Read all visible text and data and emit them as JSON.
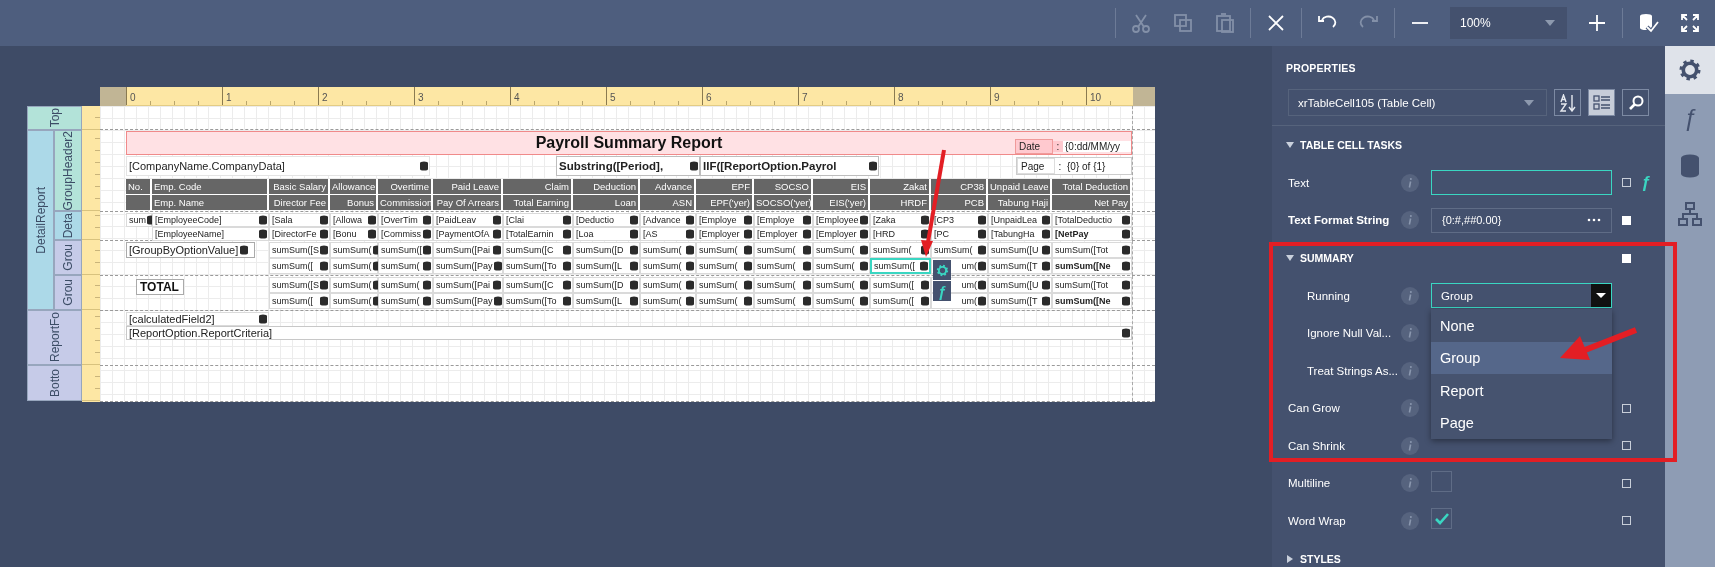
{
  "toolbar": {
    "groups": [
      {
        "buttons": [
          {
            "kind": "cut",
            "disabled": true
          },
          {
            "kind": "copy",
            "disabled": true
          },
          {
            "kind": "paste",
            "disabled": true
          }
        ]
      },
      {
        "buttons": [
          {
            "kind": "delete",
            "disabled": false
          }
        ]
      },
      {
        "buttons": [
          {
            "kind": "undo",
            "disabled": false
          },
          {
            "kind": "redo",
            "disabled": true
          }
        ]
      },
      {
        "buttons": [
          {
            "kind": "zoom_out",
            "disabled": false
          },
          {
            "kind": "zoom",
            "value": "100%",
            "disabled": false
          },
          {
            "kind": "zoom_in",
            "disabled": false
          }
        ]
      },
      {
        "buttons": [
          {
            "kind": "validate",
            "disabled": false
          },
          {
            "kind": "fullscreen",
            "disabled": false
          }
        ]
      }
    ]
  },
  "report": {
    "ruler": [
      "0",
      "1",
      "2",
      "3",
      "4",
      "5",
      "6",
      "7",
      "8",
      "9",
      "10"
    ],
    "bands": [
      {
        "kind": "top_margin",
        "label": "Top",
        "color": "#b3e3d9"
      },
      {
        "kind": "detail_report",
        "label": "DetailReport",
        "color": "#acd9e8",
        "children": [
          {
            "kind": "group_header",
            "label": "GroupHeader2",
            "color": "#b3e3d9",
            "title": "Payroll Summary Report",
            "date": {
              "label": "Date",
              "separator": ":",
              "value": "{0:dd/MM/yy"
            },
            "page": {
              "label": "Page",
              "separator": ":",
              "value": "{0} of {1}"
            },
            "company": "[CompanyName.CompanyData]",
            "period": "Substring([Period],",
            "option": "IIF([ReportOption.Payrol",
            "header_lines": [
              [
                "No.",
                "Emp. Code",
                "Basic Salary",
                "Allowance",
                "Overtime",
                "Paid Leave",
                "Claim",
                "Deduction",
                "Advance",
                "EPF",
                "SOCSO",
                "EIS",
                "Zakat",
                "CP38",
                "Unpaid Leave",
                "Total Deduction"
              ],
              [
                "Emp. Name",
                "Director Fee",
                "Bonus",
                "Commission",
                "Pay Of Arrears",
                "Total Earning",
                "Loan",
                "ASN",
                "EPF('yer)",
                "SOCSO('yer)",
                "EIS('yer)",
                "HRDF",
                "PCB",
                "Tabung Haji",
                "Net Pay"
              ]
            ]
          },
          {
            "kind": "detail",
            "label": "Deta",
            "color": "#acd9e8",
            "lines": [
              {
                "emphasize_last": false,
                "cells": [
                  "sum",
                  "[EmployeeCode]",
                  "[Sala",
                  "[Allowa",
                  "[OverTim",
                  "[PaidLeav",
                  "[Clai",
                  "[Deductio",
                  "[Advance",
                  "[Employe",
                  "[Employe",
                  "[Employee",
                  "[Zaka",
                  "[CP3",
                  "[UnpaidLea",
                  "[TotalDeductio"
                ]
              },
              {
                "emphasize_last": true,
                "cells": [
                  "[EmployeeName]",
                  "[DirectorFe",
                  "[Bonu",
                  "[Commiss",
                  "[PaymentOfA",
                  "[TotalEarnin",
                  "[Loa",
                  "[AS",
                  "[Employer",
                  "[Employer",
                  "[Employer",
                  "[HRD",
                  "[PC",
                  "[TabungHa",
                  "[NetPay"
                ]
              }
            ]
          },
          {
            "kind": "group_footer",
            "label": "Grou",
            "color": "#c6cbe8",
            "caption": {
              "kind": "field",
              "text": "[GroupByOptionValue]"
            },
            "lines": [
              {
                "emphasize_last": false,
                "cells": [
                  {
                    "text": "sumSum([S",
                    "selected": false
                  },
                  {
                    "text": "sumSum(",
                    "selected": false
                  },
                  {
                    "text": "sumSum([",
                    "selected": false
                  },
                  {
                    "text": "sumSum([Pai",
                    "selected": false
                  },
                  {
                    "text": "sumSum([C",
                    "selected": false
                  },
                  {
                    "text": "sumSum([D",
                    "selected": false
                  },
                  {
                    "text": "sumSum(",
                    "selected": false
                  },
                  {
                    "text": "sumSum(",
                    "selected": false
                  },
                  {
                    "text": "sumSum(",
                    "selected": false
                  },
                  {
                    "text": "sumSum(",
                    "selected": false
                  },
                  {
                    "text": "sumSum(",
                    "selected": false
                  },
                  {
                    "text": "sumSum(",
                    "selected": false
                  },
                  {
                    "text": "sumSum([U",
                    "selected": false
                  },
                  {
                    "text": "sumSum([Tot",
                    "selected": false
                  }
                ]
              },
              {
                "emphasize_last": true,
                "cells": [
                  {
                    "text": "sumSum([",
                    "selected": false
                  },
                  {
                    "text": "sumSum(",
                    "selected": false
                  },
                  {
                    "text": "sumSum(",
                    "selected": false
                  },
                  {
                    "text": "sumSum([Pay",
                    "selected": false
                  },
                  {
                    "text": "sumSum([To",
                    "selected": false
                  },
                  {
                    "text": "sumSum([L",
                    "selected": false
                  },
                  {
                    "text": "sumSum(",
                    "selected": false
                  },
                  {
                    "text": "sumSum(",
                    "selected": false
                  },
                  {
                    "text": "sumSum(",
                    "selected": false
                  },
                  {
                    "text": "sumSum(",
                    "selected": false
                  },
                  {
                    "text": "sumSum([",
                    "selected": true
                  },
                  {
                    "text": "um(",
                    "selected": false
                  },
                  {
                    "text": "sumSum([T",
                    "selected": false
                  },
                  {
                    "text": "sumSum([Ne",
                    "selected": false
                  }
                ]
              }
            ]
          },
          {
            "kind": "group_footer",
            "label": "Grou",
            "color": "#c6cbe8",
            "caption": {
              "kind": "label",
              "text": "TOTAL"
            },
            "lines": [
              {
                "emphasize_last": false,
                "cells": [
                  {
                    "text": "sumSum([S",
                    "selected": false
                  },
                  {
                    "text": "sumSum(",
                    "selected": false
                  },
                  {
                    "text": "sumSum(",
                    "selected": false
                  },
                  {
                    "text": "sumSum([Pai",
                    "selected": false
                  },
                  {
                    "text": "sumSum([C",
                    "selected": false
                  },
                  {
                    "text": "sumSum([D",
                    "selected": false
                  },
                  {
                    "text": "sumSum(",
                    "selected": false
                  },
                  {
                    "text": "sumSum(",
                    "selected": false
                  },
                  {
                    "text": "sumSum(",
                    "selected": false
                  },
                  {
                    "text": "sumSum(",
                    "selected": false
                  },
                  {
                    "text": "sumSum([",
                    "selected": false
                  },
                  {
                    "text": "um(",
                    "selected": false
                  },
                  {
                    "text": "sumSum([U",
                    "selected": false
                  },
                  {
                    "text": "sumSum([Tot",
                    "selected": false
                  }
                ]
              },
              {
                "emphasize_last": true,
                "cells": [
                  {
                    "text": "sumSum([",
                    "selected": false
                  },
                  {
                    "text": "sumSum(",
                    "selected": false
                  },
                  {
                    "text": "sumSum(",
                    "selected": false
                  },
                  {
                    "text": "sumSum([Pay",
                    "selected": false
                  },
                  {
                    "text": "sumSum([To",
                    "selected": false
                  },
                  {
                    "text": "sumSum([L",
                    "selected": false
                  },
                  {
                    "text": "sumSum(",
                    "selected": false
                  },
                  {
                    "text": "sumSum(",
                    "selected": false
                  },
                  {
                    "text": "sumSum(",
                    "selected": false
                  },
                  {
                    "text": "sumSum(",
                    "selected": false
                  },
                  {
                    "text": "sumSum([",
                    "selected": false
                  },
                  {
                    "text": "um(",
                    "selected": false
                  },
                  {
                    "text": "sumSum([T",
                    "selected": false
                  },
                  {
                    "text": "sumSum([Ne",
                    "selected": false
                  }
                ]
              }
            ]
          }
        ]
      },
      {
        "kind": "report_footer",
        "label": "ReportFo",
        "color": "#c6cbe8",
        "fields": [
          {
            "kind": "short",
            "text": "[calculatedField2]"
          },
          {
            "kind": "wide",
            "text": "[ReportOption.ReportCriteria]"
          }
        ]
      },
      {
        "kind": "bottom_margin",
        "label": "Botto",
        "color": "#c6cbe8"
      }
    ],
    "smart_tag": {
      "glyph": "ƒ"
    }
  },
  "properties": {
    "title": "PROPERTIES",
    "selector": "xrTableCell105 (Table Cell)",
    "tools": [
      {
        "kind": "sort",
        "selected": false
      },
      {
        "kind": "categories",
        "selected": true
      },
      {
        "kind": "search",
        "selected": false
      }
    ],
    "sections": [
      {
        "kind": "section",
        "title": "TABLE CELL TASKS",
        "expanded": true,
        "rows": [
          {
            "kind": "input",
            "label": "Text",
            "focused": true,
            "modified": false,
            "expression_glyph": "ƒ"
          },
          {
            "kind": "editor",
            "label": "Text Format String",
            "value": "{0:#,##0.00}",
            "focused": false,
            "modified": true
          },
          {
            "kind": "section",
            "title": "SUMMARY",
            "expanded": true,
            "modified": true,
            "rows": [
              {
                "kind": "dropdown",
                "label": "Running",
                "value": "Group",
                "open": true,
                "options": [
                  {
                    "label": "None",
                    "selected": false
                  },
                  {
                    "label": "Group",
                    "selected": true
                  },
                  {
                    "label": "Report",
                    "selected": false
                  },
                  {
                    "label": "Page",
                    "selected": false
                  }
                ]
              },
              {
                "kind": "plain",
                "label": "Ignore Null Val..."
              },
              {
                "kind": "plain",
                "label": "Treat Strings As..."
              }
            ]
          },
          {
            "kind": "plain",
            "label": "Can Grow",
            "modified": false
          },
          {
            "kind": "plain",
            "label": "Can Shrink",
            "modified": false
          },
          {
            "kind": "checkbox",
            "label": "Multiline",
            "checked": false,
            "modified": false
          },
          {
            "kind": "checkbox",
            "label": "Word Wrap",
            "checked": true,
            "modified": false
          }
        ]
      },
      {
        "kind": "section",
        "title": "STYLES",
        "expanded": false
      }
    ]
  },
  "side_tabs": [
    {
      "kind": "properties",
      "selected": true
    },
    {
      "kind": "expressions",
      "selected": false,
      "glyph": "ƒ"
    },
    {
      "kind": "fields",
      "selected": false
    },
    {
      "kind": "outline",
      "selected": false
    }
  ]
}
